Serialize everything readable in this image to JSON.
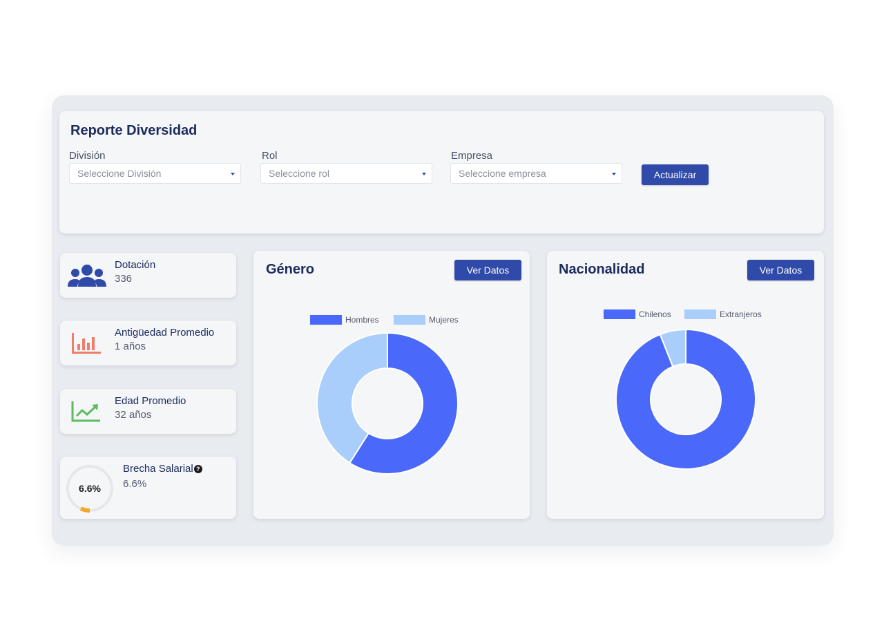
{
  "report_title": "Reporte Diversidad",
  "filters": [
    {
      "label": "División",
      "placeholder": "Seleccione División"
    },
    {
      "label": "Rol",
      "placeholder": "Seleccione rol"
    },
    {
      "label": "Empresa",
      "placeholder": "Seleccione empresa"
    }
  ],
  "update_button": "Actualizar",
  "stats": [
    {
      "title": "Dotación",
      "value": "336",
      "icon": "users-icon"
    },
    {
      "title": "Antigüedad Promedio",
      "value": "1 años",
      "icon": "bar-chart-icon"
    },
    {
      "title": "Edad Promedio",
      "value": "32 años",
      "icon": "trending-up-icon"
    },
    {
      "title": "Brecha Salarial",
      "value": "6.6%",
      "icon": "help-icon",
      "ring_label": "6.6%",
      "ring_fraction": 0.066
    }
  ],
  "colors": {
    "primary": "#2f4aa8",
    "series_a": "#4a68f9",
    "series_b": "#a9cefc",
    "red_icon": "#f07d6a",
    "green_icon": "#5dbb5d",
    "gauge": "#f5a623"
  },
  "charts": [
    {
      "title": "Género",
      "button": "Ver Datos",
      "chart_data": {
        "type": "pie",
        "categories": [
          "Hombres",
          "Mujeres"
        ],
        "values": [
          59,
          41
        ]
      }
    },
    {
      "title": "Nacionalidad",
      "button": "Ver Datos",
      "chart_data": {
        "type": "pie",
        "categories": [
          "Chilenos",
          "Extranjeros"
        ],
        "values": [
          94,
          6
        ]
      }
    }
  ]
}
